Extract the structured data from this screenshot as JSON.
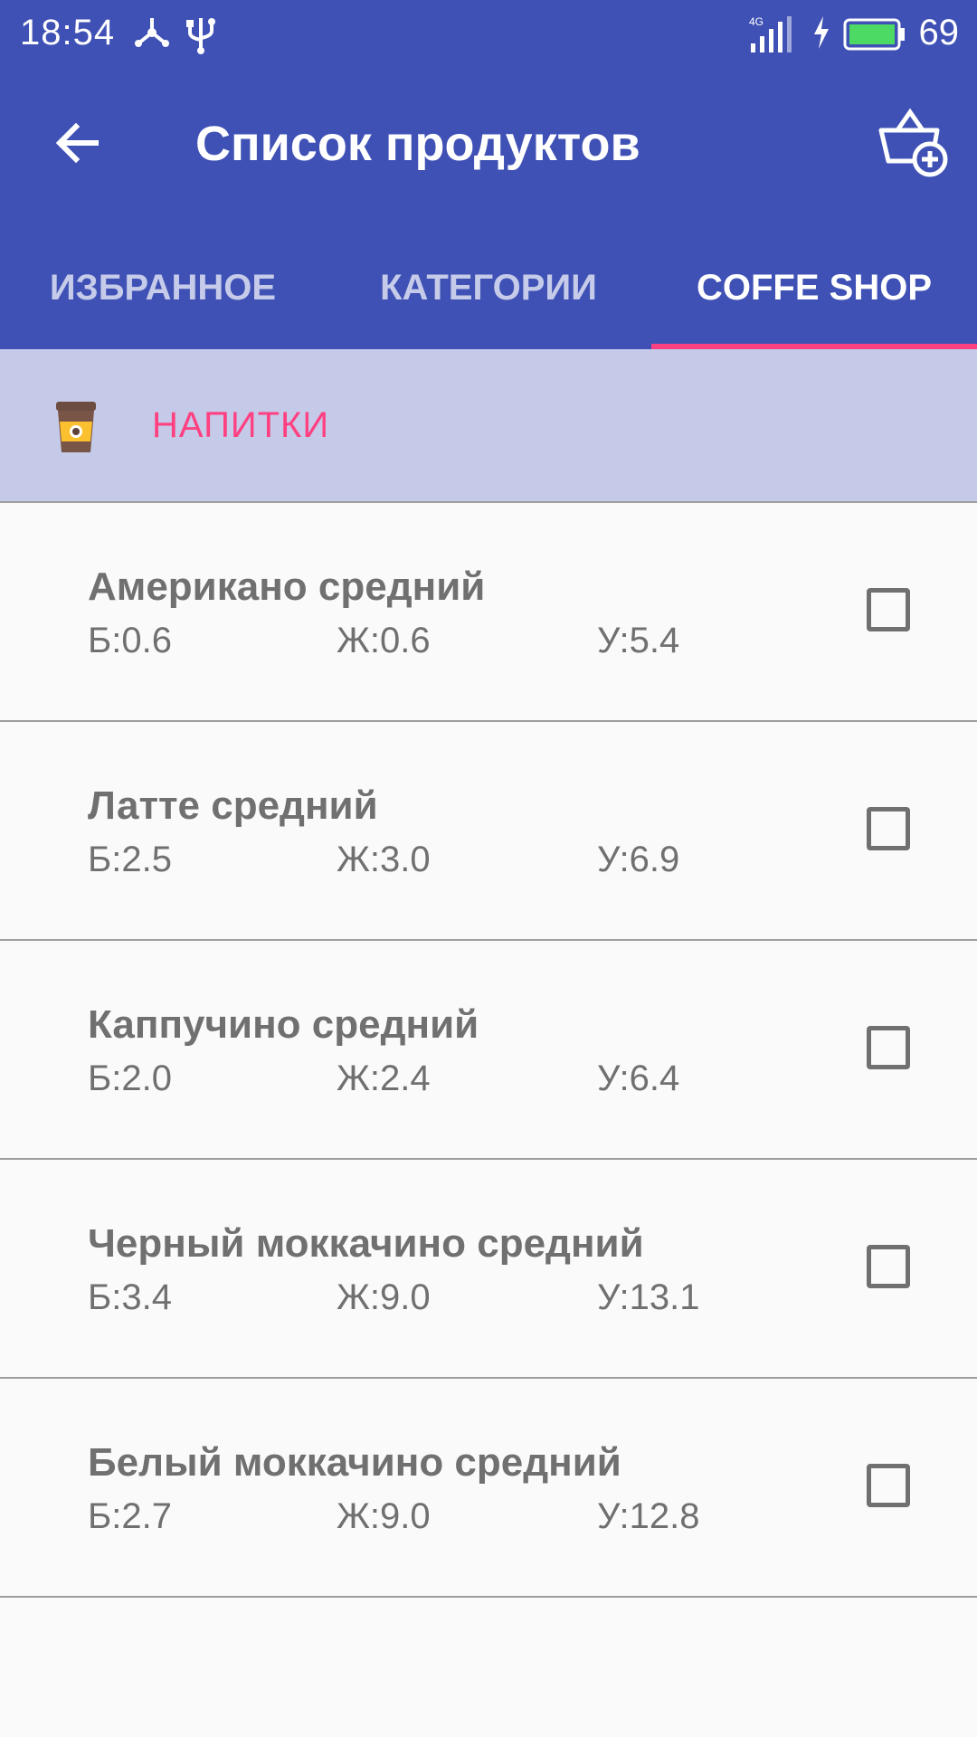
{
  "status_bar": {
    "time": "18:54",
    "battery_level": "69",
    "icons": [
      "usb-share-icon",
      "usb-icon",
      "signal-4g-icon",
      "charging-icon",
      "battery-icon"
    ]
  },
  "toolbar": {
    "title": "Список продуктов",
    "back_icon": "arrow-back-icon",
    "action_icon": "basket-add-icon"
  },
  "tabs": [
    {
      "label": "ИЗБРАННОЕ",
      "active": false
    },
    {
      "label": "КАТЕГОРИИ",
      "active": false
    },
    {
      "label": "COFFE SHOP",
      "active": true
    }
  ],
  "category": {
    "label": "НАПИТКИ",
    "icon": "coffee-cup-icon"
  },
  "products": [
    {
      "name": "Американо средний",
      "protein": "Б:0.6",
      "fat": "Ж:0.6",
      "carbs": "У:5.4",
      "checked": false
    },
    {
      "name": "Латте средний",
      "protein": "Б:2.5",
      "fat": "Ж:3.0",
      "carbs": "У:6.9",
      "checked": false
    },
    {
      "name": "Каппучино средний",
      "protein": "Б:2.0",
      "fat": "Ж:2.4",
      "carbs": "У:6.4",
      "checked": false
    },
    {
      "name": "Черный моккачино средний",
      "protein": "Б:3.4",
      "fat": "Ж:9.0",
      "carbs": "У:13.1",
      "checked": false
    },
    {
      "name": "Белый моккачино средний",
      "protein": "Б:2.7",
      "fat": "Ж:9.0",
      "carbs": "У:12.8",
      "checked": false
    }
  ],
  "colors": {
    "primary": "#3f51b5",
    "accent": "#ff4081",
    "category_bg": "#c5cae9",
    "text_secondary": "#707070"
  }
}
